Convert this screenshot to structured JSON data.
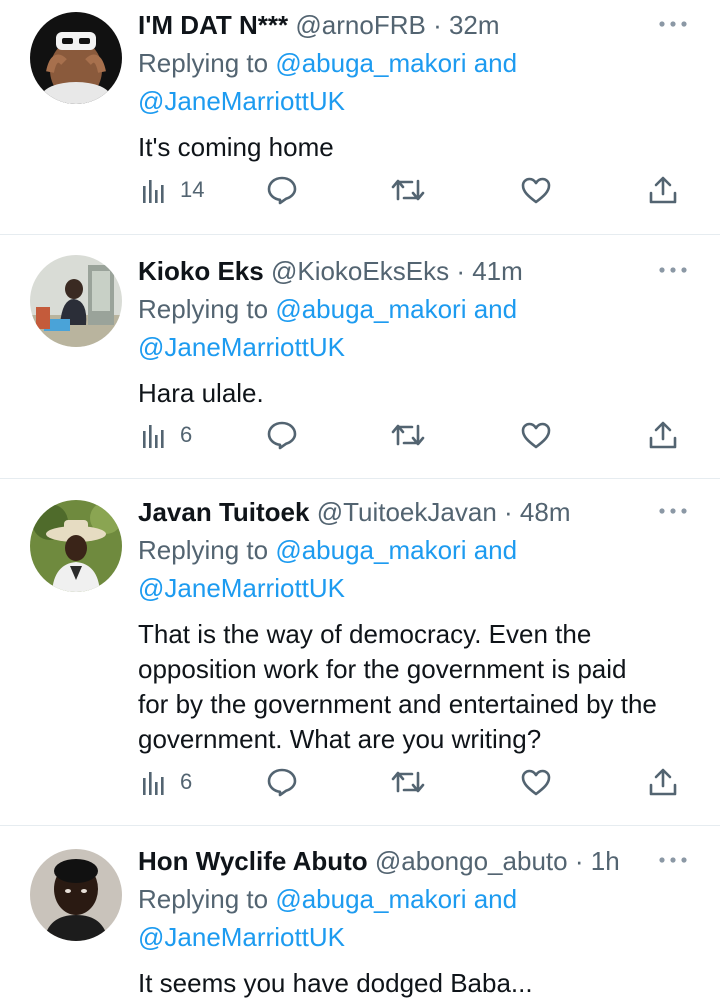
{
  "tweets": [
    {
      "display_name": "I'M DAT N***",
      "handle": "@arnoFRB",
      "time": "32m",
      "reply_prefix": "Replying to",
      "mention1": "@abuga_makori",
      "and_word": "and",
      "mention2": "@JaneMarriottUK",
      "text": "It's coming home",
      "views": "14"
    },
    {
      "display_name": "Kioko Eks",
      "handle": "@KiokoEksEks",
      "time": "41m",
      "reply_prefix": "Replying to",
      "mention1": "@abuga_makori",
      "and_word": "and",
      "mention2": "@JaneMarriottUK",
      "text": "Hara ulale.",
      "views": "6"
    },
    {
      "display_name": "Javan Tuitoek",
      "handle": "@TuitoekJavan",
      "time": "48m",
      "reply_prefix": "Replying to",
      "mention1": "@abuga_makori",
      "and_word": "and",
      "mention2": "@JaneMarriottUK",
      "text_lines": [
        "That is the way of democracy. Even the",
        "opposition work for the government is paid",
        "for by the government and entertained by the",
        "government. What are you writing?"
      ],
      "views": "6"
    },
    {
      "display_name": "Hon Wyclife Abuto",
      "handle": "@abongo_abuto",
      "time": "1h",
      "reply_prefix": "Replying to",
      "mention1": "@abuga_makori",
      "and_word": "and",
      "mention2": "@JaneMarriottUK",
      "text": "It seems you have dodged Baba..."
    }
  ],
  "separator": "·",
  "icons": {
    "views": "views-icon",
    "reply": "reply-icon",
    "retweet": "retweet-icon",
    "like": "like-icon",
    "share": "share-icon",
    "more": "more-icon"
  },
  "colors": {
    "link": "#1d9bf0",
    "secondary": "#536471",
    "primary": "#0f1419",
    "divider": "#e6ecf0"
  }
}
